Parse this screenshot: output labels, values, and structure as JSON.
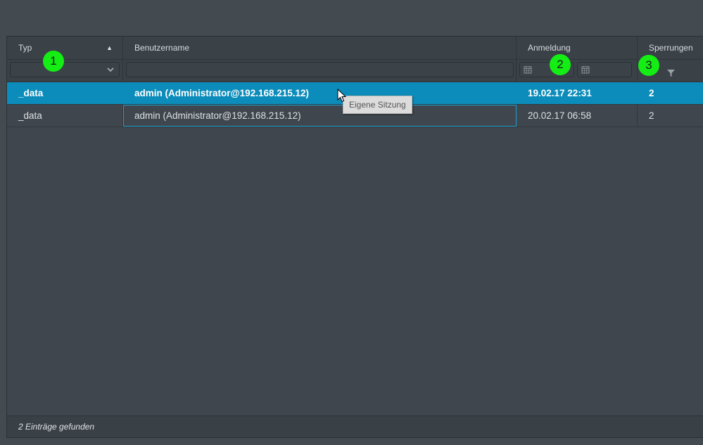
{
  "columns": {
    "typ": "Typ",
    "benutzername": "Benutzername",
    "anmeldung": "Anmeldung",
    "sperrungen": "Sperrungen"
  },
  "filters": {
    "typ_value": "",
    "benutzername_value": "",
    "anmeldung_from": "",
    "anmeldung_to": ""
  },
  "rows": [
    {
      "typ": "_data",
      "benutzername": "admin (Administrator@192.168.215.12)",
      "anmeldung": "19.02.17 22:31",
      "sperrungen": "2",
      "selected": true
    },
    {
      "typ": "_data",
      "benutzername": "admin (Administrator@192.168.215.12)",
      "anmeldung": "20.02.17 06:58",
      "sperrungen": "2",
      "selected": false
    }
  ],
  "tooltip": "Eigene Sitzung",
  "footer": "2 Einträge gefunden",
  "annotations": [
    "1",
    "2",
    "3"
  ],
  "icons": [
    "sort-ascending-icon",
    "chevron-down-icon",
    "calendar-icon",
    "filter-icon",
    "mouse-cursor-icon"
  ],
  "colors": {
    "selection": "#0c8cba",
    "annotation": "#14ee14",
    "background": "#434a50"
  }
}
